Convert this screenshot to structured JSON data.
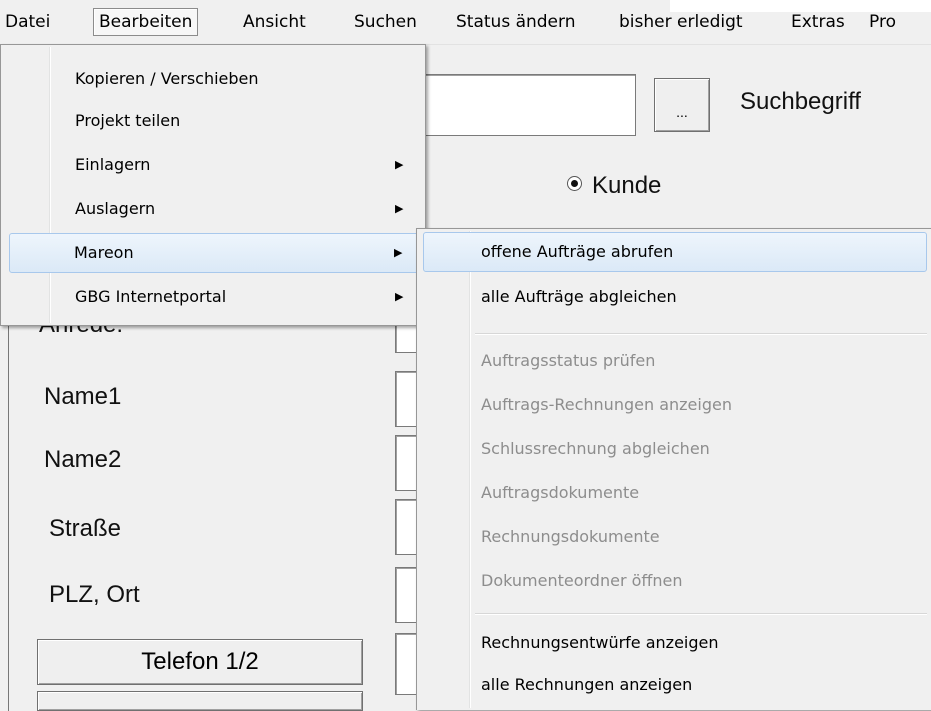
{
  "menubar": {
    "items": [
      "Datei",
      "Bearbeiten",
      "Ansicht",
      "Suchen",
      "Status ändern",
      "bisher erledigt",
      "Extras",
      "Pro"
    ]
  },
  "form": {
    "search_button_label": "...",
    "suchbegriff_label": "Suchbegriff",
    "radio_kunde_label": "Kunde",
    "anrede_label": "Anrede:",
    "name1_label": "Name1",
    "name2_label": "Name2",
    "strasse_label": "Straße",
    "plz_ort_label": "PLZ, Ort",
    "telefon_button_label": "Telefon 1/2"
  },
  "bearbeiten_menu": {
    "items": [
      {
        "label": "Kopieren / Verschieben",
        "submenu": false
      },
      {
        "label": "Projekt teilen",
        "submenu": false
      },
      {
        "label": "Einlagern",
        "submenu": true
      },
      {
        "label": "Auslagern",
        "submenu": true
      },
      {
        "label": "Mareon",
        "submenu": true,
        "highlighted": true
      },
      {
        "label": "GBG Internetportal",
        "submenu": true
      }
    ]
  },
  "mareon_submenu": {
    "items": [
      {
        "label": "offene Aufträge abrufen",
        "enabled": true,
        "highlighted": true
      },
      {
        "label": "alle Aufträge abgleichen",
        "enabled": true
      },
      {
        "label": "Auftragsstatus prüfen",
        "enabled": false
      },
      {
        "label": "Auftrags-Rechnungen anzeigen",
        "enabled": false
      },
      {
        "label": "Schlussrechnung abgleichen",
        "enabled": false
      },
      {
        "label": "Auftragsdokumente",
        "enabled": false
      },
      {
        "label": "Rechnungsdokumente",
        "enabled": false
      },
      {
        "label": "Dokumenteordner öffnen",
        "enabled": false
      },
      {
        "label": "Rechnungsentwürfe anzeigen",
        "enabled": true
      },
      {
        "label": "alle Rechnungen anzeigen",
        "enabled": true
      }
    ]
  },
  "colors": {
    "highlight_border": "#a8c8ec",
    "disabled_text": "#8d8d8d",
    "menu_bg": "#f0f0f0"
  }
}
